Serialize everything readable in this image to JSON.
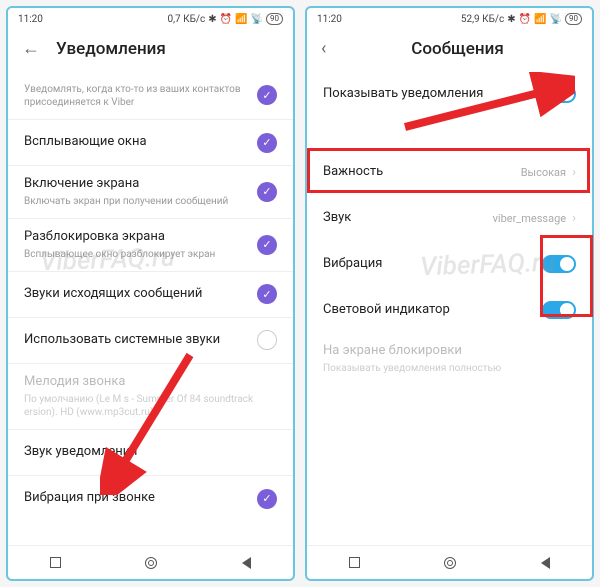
{
  "left": {
    "status": {
      "time": "11:20",
      "net": "0,7 КБ/с",
      "batt": "90"
    },
    "title": "Уведомления",
    "rows": {
      "r0": {
        "label": "",
        "sub": "Уведомлять, когда кто-то из ваших контактов присоединяется к Viber"
      },
      "r1": {
        "label": "Всплывающие окна"
      },
      "r2": {
        "label": "Включение экрана",
        "sub": "Включать экран при получении сообщений"
      },
      "r3": {
        "label": "Разблокировка экрана",
        "sub": "Всплывающее окно разблокирует экран"
      },
      "r4": {
        "label": "Звуки исходящих сообщений"
      },
      "r5": {
        "label": "Использовать системные звуки"
      },
      "r6": {
        "label": "Мелодия звонка",
        "sub": "По умолчанию (Le M      s - Summer Of 84 soundtrack       ersion). HD (www.mp3cut.ru)"
      },
      "r7": {
        "label": "Звук уведомления"
      },
      "r8": {
        "label": "Вибрация при звонке"
      }
    }
  },
  "right": {
    "status": {
      "time": "11:20",
      "net": "52,9 КБ/с",
      "batt": "90"
    },
    "title": "Сообщения",
    "rows": {
      "r0": {
        "label": "Показывать уведомления"
      },
      "r1": {
        "label": "Важность",
        "value": "Высокая"
      },
      "r2": {
        "label": "Звук",
        "value": "viber_message"
      },
      "r3": {
        "label": "Вибрация"
      },
      "r4": {
        "label": "Световой индикатор"
      },
      "r5": {
        "label": "На экране блокировки",
        "sub": "Показывать уведомления полностью"
      }
    }
  },
  "watermark": "ViberFAQ.ru"
}
